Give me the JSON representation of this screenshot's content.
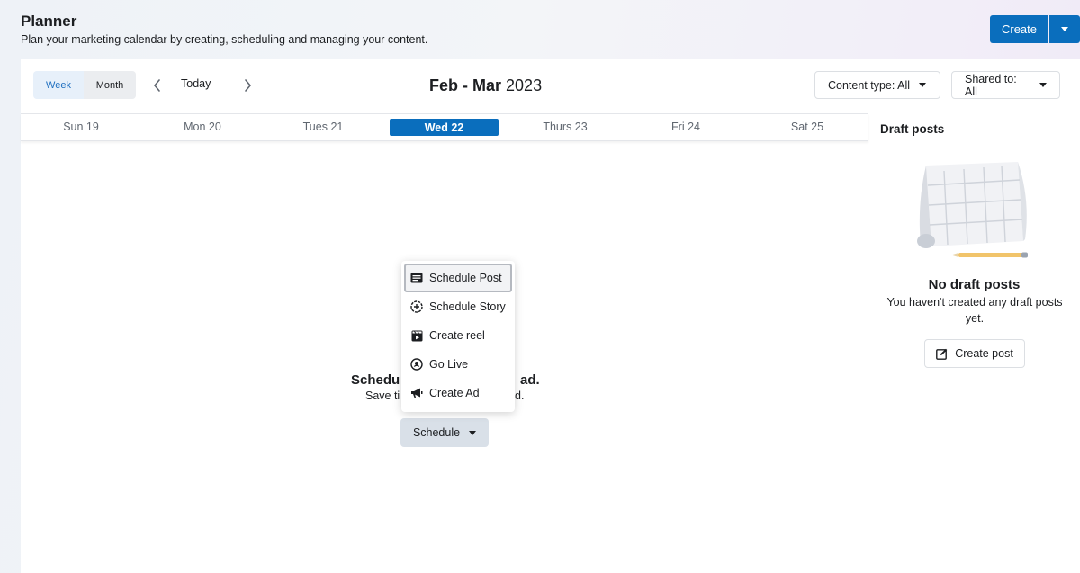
{
  "header": {
    "title": "Planner",
    "subtitle": "Plan your marketing calendar by creating, scheduling and managing your content.",
    "create_label": "Create",
    "accent_color": "#0a6ebd"
  },
  "toolbar": {
    "view_week": "Week",
    "view_month": "Month",
    "active_view": "Week",
    "today_label": "Today",
    "range_bold": "Feb - Mar",
    "range_year": "2023",
    "content_type_label": "Content type: All",
    "shared_to_label": "Shared to: All"
  },
  "calendar": {
    "days": [
      {
        "label": "Sun 19"
      },
      {
        "label": "Mon 20"
      },
      {
        "label": "Tues 21"
      },
      {
        "label": "Wed 22",
        "active": true
      },
      {
        "label": "Thurs 23"
      },
      {
        "label": "Fri 24"
      },
      {
        "label": "Sat 25"
      }
    ]
  },
  "empty_state": {
    "title_visible_start": "Schedu",
    "title_visible_end": "ad.",
    "desc_visible_start": "Save ti",
    "desc_visible_end": "d.",
    "schedule_label": "Schedule"
  },
  "schedule_menu": {
    "items": [
      {
        "label": "Schedule Post",
        "icon": "post-icon",
        "focused": true
      },
      {
        "label": "Schedule Story",
        "icon": "story-plus-icon"
      },
      {
        "label": "Create reel",
        "icon": "reel-icon"
      },
      {
        "label": "Go Live",
        "icon": "live-icon"
      },
      {
        "label": "Create Ad",
        "icon": "megaphone-icon"
      }
    ]
  },
  "sidebar": {
    "title": "Draft posts",
    "empty_title": "No draft posts",
    "empty_desc": "You haven't created any draft posts yet.",
    "create_post_label": "Create post"
  }
}
